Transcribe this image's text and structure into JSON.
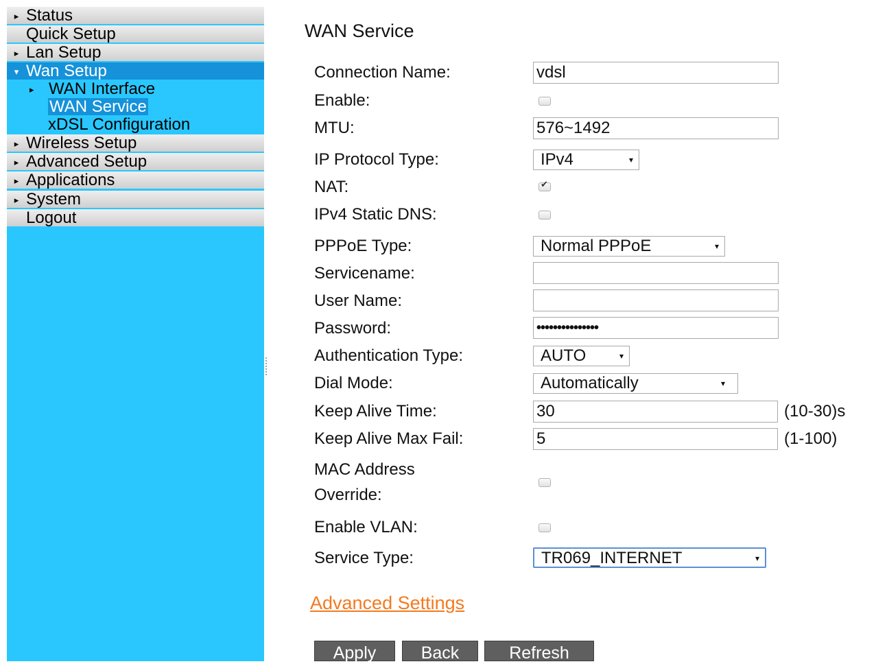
{
  "sidebar": {
    "items": [
      {
        "label": "Status"
      },
      {
        "label": "Quick Setup"
      },
      {
        "label": "Lan Setup"
      },
      {
        "label": "Wan Setup"
      },
      {
        "label": "Wireless Setup"
      },
      {
        "label": "Advanced Setup"
      },
      {
        "label": "Applications"
      },
      {
        "label": "System"
      },
      {
        "label": "Logout"
      }
    ],
    "wan_sub": [
      {
        "label": "WAN Interface"
      },
      {
        "label": "WAN Service"
      },
      {
        "label": "xDSL Configuration"
      }
    ]
  },
  "page": {
    "title": "WAN Service"
  },
  "form": {
    "connection_name": {
      "label": "Connection Name:",
      "value": "vdsl"
    },
    "enable": {
      "label": "Enable:",
      "checked": false
    },
    "mtu": {
      "label": "MTU:",
      "value": "576~1492"
    },
    "ip_protocol": {
      "label": "IP Protocol Type:",
      "value": "IPv4"
    },
    "nat": {
      "label": "NAT:",
      "checked": true
    },
    "ipv4_static_dns": {
      "label": "IPv4 Static DNS:",
      "checked": false
    },
    "pppoe_type": {
      "label": "PPPoE Type:",
      "value": "Normal PPPoE"
    },
    "servicename": {
      "label": "Servicename:",
      "value": ""
    },
    "user_name": {
      "label": "User Name:",
      "value": ""
    },
    "password": {
      "label": "Password:",
      "value": "•••••••••••••••"
    },
    "auth_type": {
      "label": "Authentication Type:",
      "value": "AUTO"
    },
    "dial_mode": {
      "label": "Dial Mode:",
      "value": "Automatically"
    },
    "keep_alive_time": {
      "label": "Keep Alive Time:",
      "value": "30",
      "hint": "(10-30)s"
    },
    "keep_alive_max_fail": {
      "label": "Keep Alive Max Fail:",
      "value": "5",
      "hint": "(1-100)"
    },
    "mac_override": {
      "label_line1": "MAC Address",
      "label_line2": "Override:",
      "checked": false
    },
    "enable_vlan": {
      "label": "Enable VLAN:",
      "checked": false
    },
    "service_type": {
      "label": "Service Type:",
      "value": "TR069_INTERNET"
    }
  },
  "advanced_link": "Advanced Settings",
  "buttons": {
    "apply": "Apply",
    "back": "Back",
    "refresh": "Refresh"
  },
  "colors": {
    "sidebar_bg": "#29c7fd",
    "active_bg": "#1592d9",
    "link": "#f47a1f",
    "button_bg": "#5f5f5f"
  },
  "icons": {
    "collapsed": "triangle-right",
    "expanded": "triangle-down"
  }
}
